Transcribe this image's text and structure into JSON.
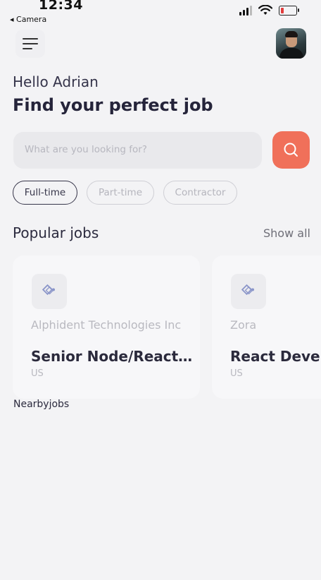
{
  "status_bar": {
    "time": "12:34",
    "back_label": "◂ Camera"
  },
  "header": {
    "greeting": "Hello Adrian",
    "headline": "Find your perfect job"
  },
  "search": {
    "placeholder": "What are you looking for?"
  },
  "filters": [
    {
      "label": "Full-time",
      "active": true
    },
    {
      "label": "Part-time",
      "active": false
    },
    {
      "label": "Contractor",
      "active": false
    }
  ],
  "popular": {
    "title": "Popular jobs",
    "show_all": "Show all",
    "cards": [
      {
        "company": "Alphident Technologies Inc",
        "title": "Senior Node/React…",
        "location": "US"
      },
      {
        "company": "Zora",
        "title": "React Deve",
        "location": "US"
      }
    ]
  },
  "nearby": {
    "title": "Nearbyjobs"
  },
  "colors": {
    "accent": "#f0705a",
    "text": "#25243a",
    "muted": "#b9b9c0",
    "background": "#f3f3f5"
  }
}
